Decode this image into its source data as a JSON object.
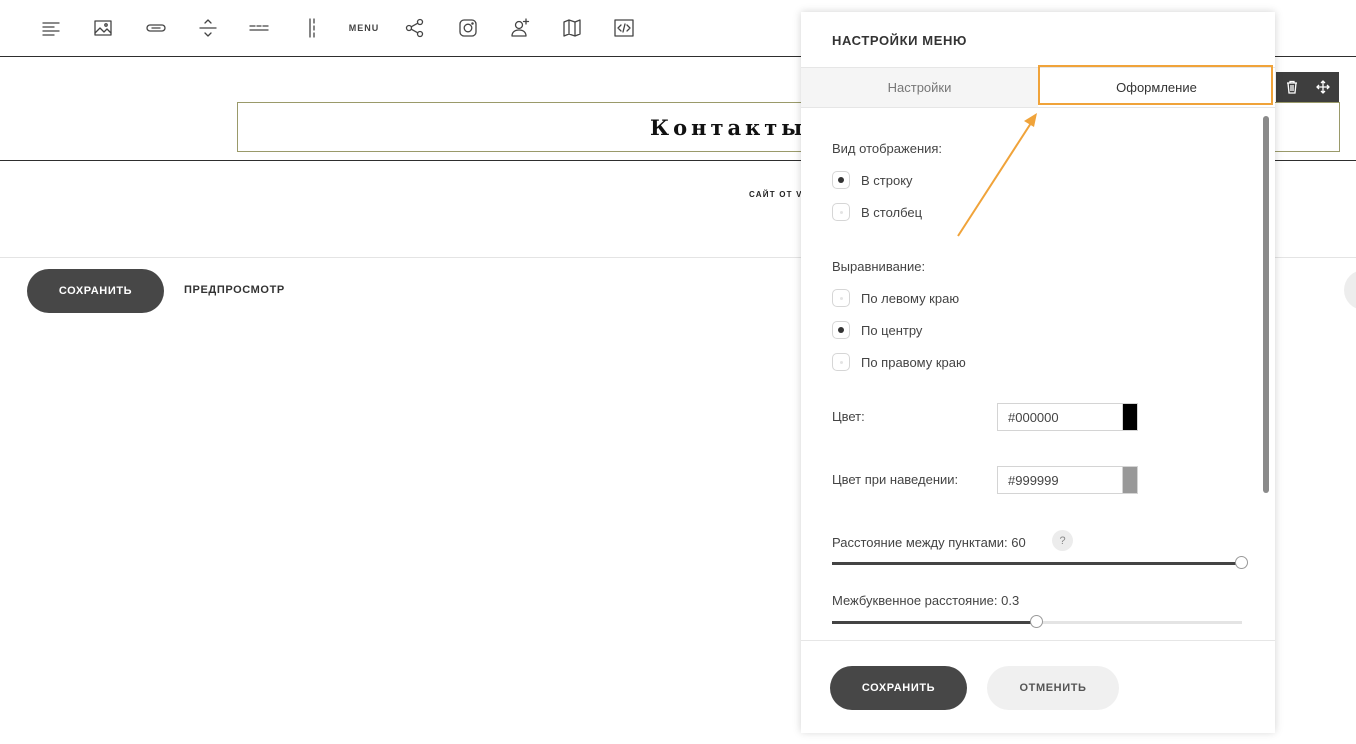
{
  "toolbar": {
    "items": [
      {
        "icon": "text-icon"
      },
      {
        "icon": "image-icon"
      },
      {
        "icon": "button-icon"
      },
      {
        "icon": "spacer-icon"
      },
      {
        "icon": "divider-icon"
      },
      {
        "icon": "column-icon"
      },
      {
        "label": "MENU"
      },
      {
        "icon": "share-icon"
      },
      {
        "icon": "instagram-icon"
      },
      {
        "icon": "add-user-icon"
      },
      {
        "icon": "map-icon"
      },
      {
        "icon": "code-icon"
      }
    ]
  },
  "canvas": {
    "menu_link": "Контакты",
    "footer_credit": "САЙТ ОТ V",
    "save_label": "СОХРАНИТЬ",
    "preview_label": "ПРЕДПРОСМОТР"
  },
  "panel": {
    "title": "НАСТРОЙКИ МЕНЮ",
    "tabs": [
      {
        "label": "Настройки",
        "active": false
      },
      {
        "label": "Оформление",
        "active": true
      }
    ],
    "display": {
      "label": "Вид отображения:",
      "options": [
        {
          "label": "В строку",
          "selected": true
        },
        {
          "label": "В столбец",
          "selected": false
        }
      ]
    },
    "alignment": {
      "label": "Выравнивание:",
      "options": [
        {
          "label": "По левому краю",
          "selected": false
        },
        {
          "label": "По центру",
          "selected": true
        },
        {
          "label": "По правому краю",
          "selected": false
        }
      ]
    },
    "color": {
      "label": "Цвет:",
      "value": "#000000"
    },
    "hover_color": {
      "label": "Цвет при наведении:",
      "value": "#999999"
    },
    "item_spacing": {
      "label": "Расстояние между пунктами: 60",
      "help": "?",
      "fraction": 1.0
    },
    "letter_spacing": {
      "label": "Межбуквенное расстояние: 0.3",
      "fraction": 0.5
    },
    "save_label": "СОХРАНИТЬ",
    "cancel_label": "ОТМЕНИТЬ"
  },
  "colors": {
    "accent_highlight": "#f0a33a",
    "button_dark": "#474747",
    "color_swatch": "#000000",
    "hover_swatch": "#999999"
  }
}
